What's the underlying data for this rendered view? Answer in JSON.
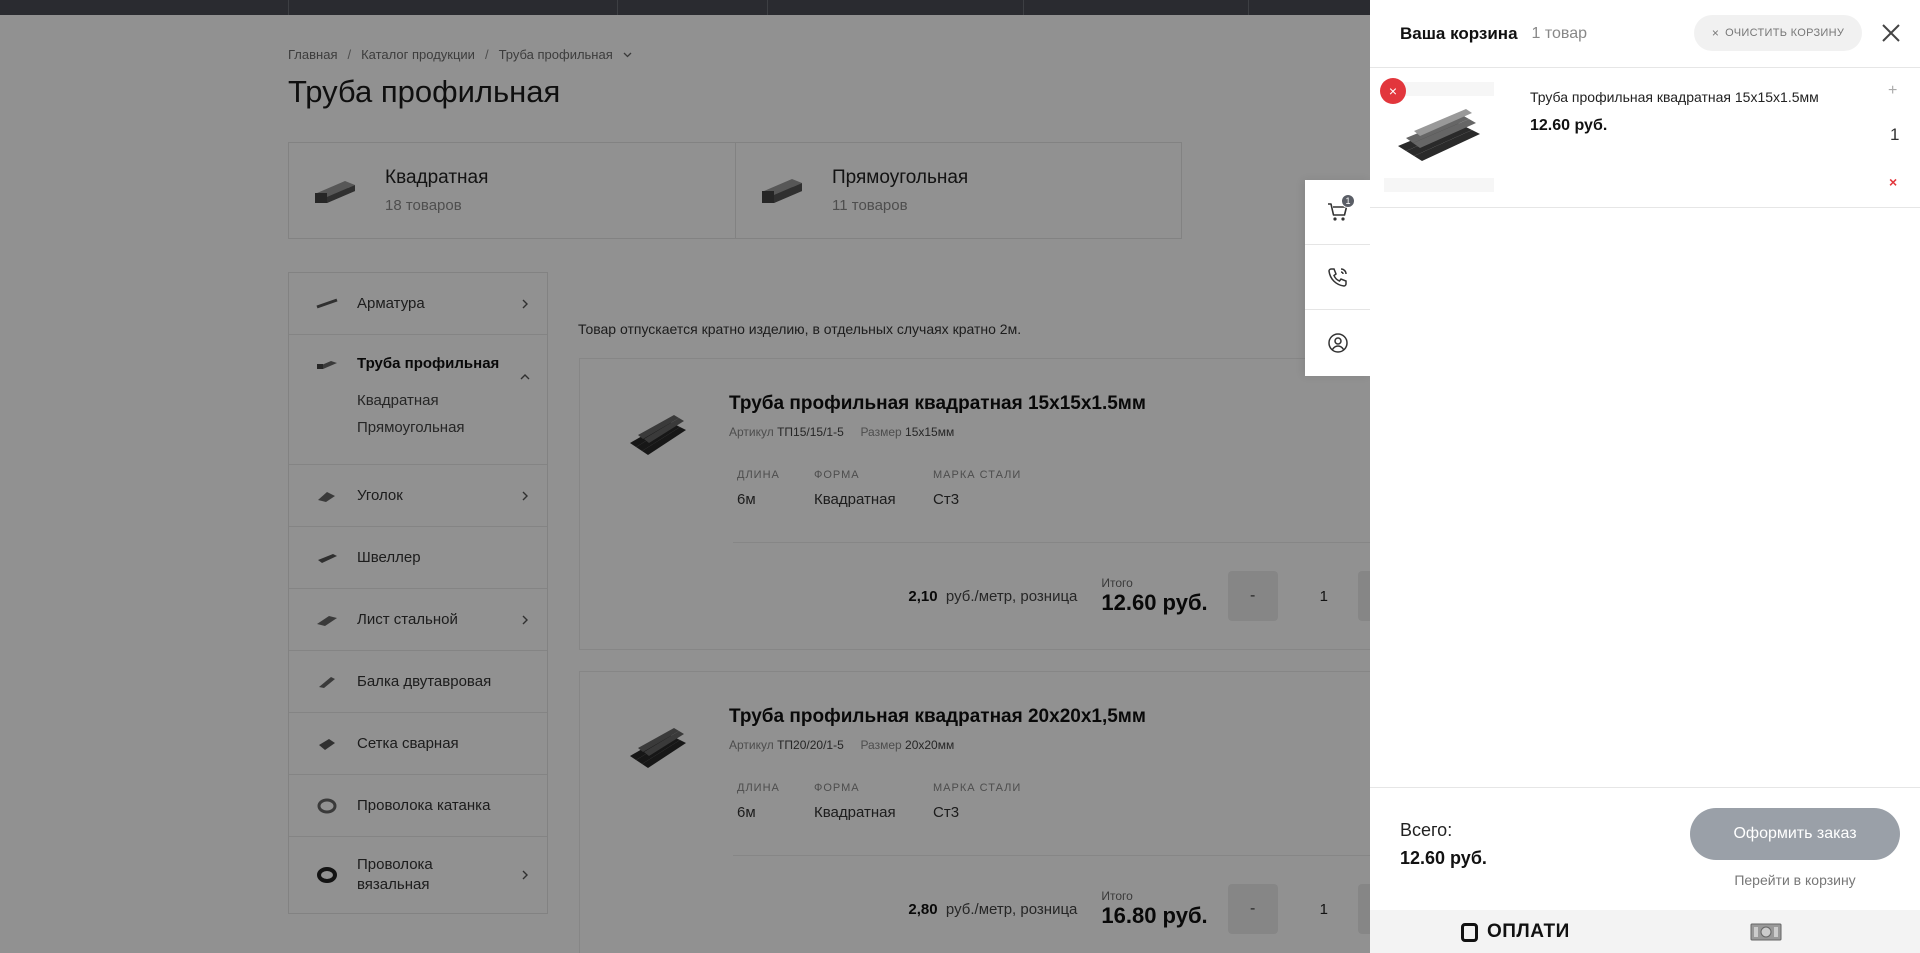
{
  "breadcrumb": {
    "home": "Главная",
    "catalog": "Каталог продукции",
    "current": "Труба профильная"
  },
  "page_title": "Труба профильная",
  "categories": [
    {
      "name": "Квадратная",
      "count": "18 товаров"
    },
    {
      "name": "Прямоугольная",
      "count": "11 товаров"
    }
  ],
  "sidebar": {
    "items": [
      {
        "label": "Арматура",
        "icon": "rebar-icon"
      },
      {
        "label": "Труба профильная",
        "icon": "profile-pipe-icon",
        "sub": [
          "Квадратная",
          "Прямоугольная"
        ]
      },
      {
        "label": "Уголок",
        "icon": "angle-icon"
      },
      {
        "label": "Швеллер",
        "icon": "channel-icon"
      },
      {
        "label": "Лист стальной",
        "icon": "steel-sheet-icon"
      },
      {
        "label": "Балка двутавровая",
        "icon": "i-beam-icon"
      },
      {
        "label": "Сетка сварная",
        "icon": "welded-mesh-icon"
      },
      {
        "label": "Проволока катанка",
        "icon": "wire-rod-icon"
      },
      {
        "label": "Проволока вязальная",
        "icon": "binding-wire-icon"
      }
    ]
  },
  "notice": "Товар отпускается кратно изделию, в отдельных случаях кратно 2м.",
  "products": [
    {
      "title": "Труба профильная квадратная 15x15x1.5мм",
      "sku_label": "Артикул",
      "sku": "ТП15/15/1-5",
      "size_label": "Размер",
      "size": "15x15мм",
      "specs": [
        {
          "k": "Длина",
          "v": "6м"
        },
        {
          "k": "Форма",
          "v": "Квадратная"
        },
        {
          "k": "Марка стали",
          "v": "Ст3"
        }
      ],
      "unit_price": "2,10",
      "unit_label": "руб./метр, розница",
      "total_label": "Итого",
      "total": "12.60 руб.",
      "minus": "-",
      "qty": "1"
    },
    {
      "title": "Труба профильная квадратная 20x20x1,5мм",
      "sku_label": "Артикул",
      "sku": "ТП20/20/1-5",
      "size_label": "Размер",
      "size": "20x20мм",
      "specs": [
        {
          "k": "Длина",
          "v": "6м"
        },
        {
          "k": "Форма",
          "v": "Квадратная"
        },
        {
          "k": "Марка стали",
          "v": "Ст3"
        }
      ],
      "unit_price": "2,80",
      "unit_label": "руб./метр, розница",
      "total_label": "Итого",
      "total": "16.80 руб.",
      "minus": "-",
      "qty": "1"
    }
  ],
  "float_widget": {
    "cart_badge": "1"
  },
  "cart": {
    "title": "Ваша корзина",
    "count": "1 товар",
    "clear_label": "Очистить корзину",
    "clear_x": "×",
    "item": {
      "name": "Труба профильная квадратная 15x15x1.5мм",
      "price": "12.60 руб.",
      "plus": "+",
      "qty": "1",
      "minus": "×",
      "remove": "×"
    },
    "total_label": "Всего:",
    "total_value": "12.60 руб.",
    "order_button": "Оформить заказ",
    "goto_cart": "Перейти в корзину",
    "payment_logo": "ОПЛАТИ"
  },
  "colors": {
    "accent_red": "#e2363c",
    "order_button": "#9aa0a8",
    "overlay": "rgba(0,0,0,0.43)"
  }
}
